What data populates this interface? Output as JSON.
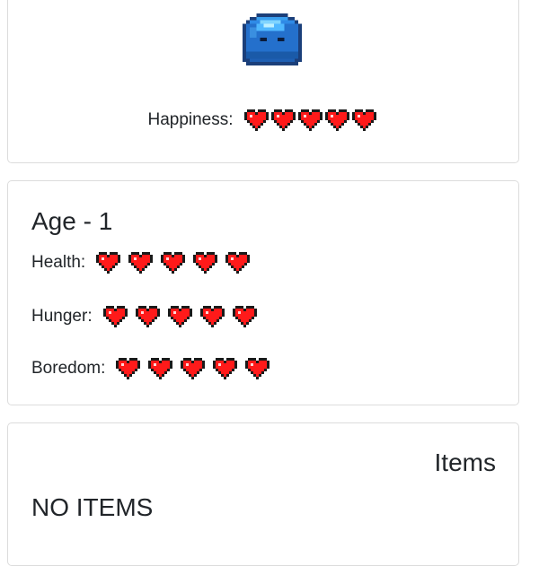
{
  "pet": {
    "sprite": "blue-slime",
    "happiness_label": "Happiness:",
    "happiness": 5,
    "happiness_max": 5
  },
  "stats": {
    "age_title": "Age - 1",
    "health_label": "Health:",
    "health": 5,
    "hunger_label": "Hunger:",
    "hunger": 5,
    "boredom_label": "Boredom:",
    "boredom": 5,
    "max": 5
  },
  "items": {
    "title": "Items",
    "empty_text": "NO ITEMS"
  },
  "colors": {
    "heart_fill": "#ff1a1a",
    "heart_outline": "#1a1a1a",
    "slime_body": "#1f6fd0",
    "card_border": "#dcdcdc"
  },
  "icons": {
    "heart": "heart-icon",
    "pet": "slime-icon"
  }
}
